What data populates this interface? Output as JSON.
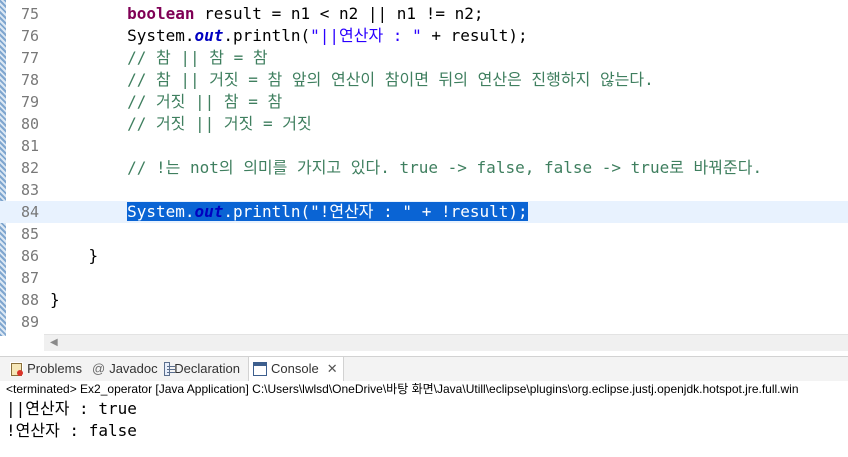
{
  "editor": {
    "lines": [
      {
        "no": "75",
        "segments": [
          {
            "t": "        ",
            "c": ""
          },
          {
            "t": "boolean",
            "c": "kw"
          },
          {
            "t": " result = n1 < n2 || n1 != n2;",
            "c": ""
          }
        ]
      },
      {
        "no": "76",
        "segments": [
          {
            "t": "        System.",
            "c": ""
          },
          {
            "t": "out",
            "c": "fi"
          },
          {
            "t": ".println(",
            "c": ""
          },
          {
            "t": "\"||연산자 : \"",
            "c": "st"
          },
          {
            "t": " + result);",
            "c": ""
          }
        ]
      },
      {
        "no": "77",
        "segments": [
          {
            "t": "        ",
            "c": ""
          },
          {
            "t": "// 참 || 참 = 참",
            "c": "cm"
          }
        ]
      },
      {
        "no": "78",
        "segments": [
          {
            "t": "        ",
            "c": ""
          },
          {
            "t": "// 참 || 거짓 = 참 앞의 연산이 참이면 뒤의 연산은 진행하지 않는다.",
            "c": "cm"
          }
        ]
      },
      {
        "no": "79",
        "segments": [
          {
            "t": "        ",
            "c": ""
          },
          {
            "t": "// 거짓 || 참 = 참",
            "c": "cm"
          }
        ]
      },
      {
        "no": "80",
        "segments": [
          {
            "t": "        ",
            "c": ""
          },
          {
            "t": "// 거짓 || 거짓 = 거짓",
            "c": "cm"
          }
        ]
      },
      {
        "no": "81",
        "segments": []
      },
      {
        "no": "82",
        "segments": [
          {
            "t": "        ",
            "c": ""
          },
          {
            "t": "// !는 not의 의미를 가지고 있다. true -> false, false -> true로 바꿔준다.",
            "c": "cm"
          }
        ]
      },
      {
        "no": "83",
        "segments": []
      },
      {
        "no": "84",
        "current": true,
        "segments": [
          {
            "t": "        ",
            "c": ""
          },
          {
            "t": "System.",
            "c": "sel"
          },
          {
            "t": "out",
            "c": "sel fi"
          },
          {
            "t": ".println(\"!연산자 : \" + !result);",
            "c": "sel"
          }
        ]
      },
      {
        "no": "85",
        "segments": []
      },
      {
        "no": "86",
        "segments": [
          {
            "t": "    }",
            "c": ""
          }
        ]
      },
      {
        "no": "87",
        "segments": []
      },
      {
        "no": "88",
        "segments": [
          {
            "t": "}",
            "c": ""
          }
        ]
      },
      {
        "no": "89",
        "segments": []
      }
    ]
  },
  "tabs": {
    "problems": "Problems",
    "javadoc": "Javadoc",
    "declaration": "Declaration",
    "console": "Console",
    "close_glyph": "✕"
  },
  "console": {
    "status": "<terminated> Ex2_operator [Java Application] C:\\Users\\lwlsd\\OneDrive\\바탕 화면\\Java\\Utill\\eclipse\\plugins\\org.eclipse.justj.openjdk.hotspot.jre.full.win",
    "output": [
      "||연산자 : true",
      "!연산자 : false"
    ]
  },
  "colors": {
    "keyword": "#7f0055",
    "string": "#2a00ff",
    "field": "#0000c0",
    "comment": "#3f7f5f",
    "selection": "#0a64d4",
    "current_line": "#e8f2fe"
  }
}
